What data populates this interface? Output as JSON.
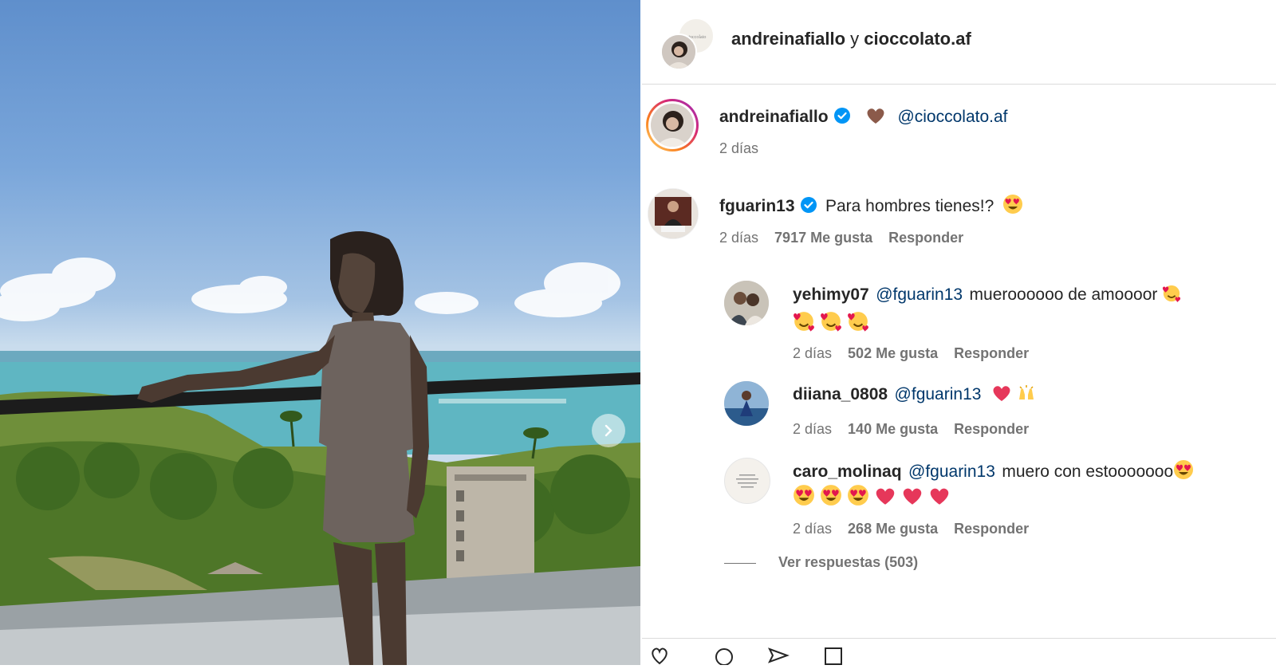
{
  "header": {
    "user1": "andreinafiallo",
    "conj": "y",
    "user2": "cioccolato.af"
  },
  "caption": {
    "username": "andreinafiallo",
    "mention": "@cioccolato.af",
    "time": "2 días"
  },
  "comment": {
    "username": "fguarin13",
    "text": "Para hombres tienes!?",
    "time": "2 días",
    "likes": "7917 Me gusta",
    "reply_label": "Responder"
  },
  "replies": [
    {
      "username": "yehimy07",
      "mention": "@fguarin13",
      "text": "mueroooooo de amoooor",
      "time": "2 días",
      "likes": "502 Me gusta",
      "reply_label": "Responder"
    },
    {
      "username": "diiana_0808",
      "mention": "@fguarin13",
      "text": "",
      "time": "2 días",
      "likes": "140 Me gusta",
      "reply_label": "Responder"
    },
    {
      "username": "caro_molinaq",
      "mention": "@fguarin13",
      "text": "muero con estooooooo",
      "time": "2 días",
      "likes": "268 Me gusta",
      "reply_label": "Responder"
    }
  ],
  "view_replies": "Ver respuestas (503)",
  "colors": {
    "verified": "#0095f6",
    "mention": "#00376b",
    "secondary_text": "#737373",
    "story_ring": "#d62976"
  },
  "icons": [
    "verified-badge-icon",
    "brown-heart-icon",
    "heart-eyes-emoji",
    "smiling-hearts-emoji",
    "red-heart-icon",
    "raising-hands-emoji",
    "chevron-right-icon"
  ]
}
